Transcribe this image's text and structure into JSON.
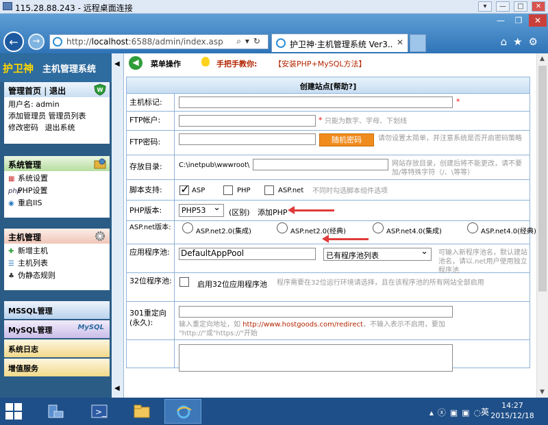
{
  "rdp": {
    "title": "115.28.88.243 - 远程桌面连接",
    "buttons": [
      "▾",
      "—",
      "□",
      "✕"
    ]
  },
  "browser": {
    "url_prefix": "http://",
    "url_host": "localhost",
    "url_rest": ":6588/admin/index.asp",
    "addr_tools": "⌕▾↻",
    "tab_label": "护卫神·主机管理系统 Ver3...",
    "tab_close": "✕",
    "window_buttons": [
      "—",
      "❐",
      "✕"
    ],
    "right_icons": "⌂★⚙",
    "back": "←",
    "forward": "→"
  },
  "sidebar": {
    "brand_name": "护卫神",
    "brand_sub": "主机管理系统",
    "collapse_arrow": "◀",
    "account_panel": {
      "home_label": "管理首页",
      "logout_label": "退出",
      "username_line": "用户名: admin",
      "add_admin": "添加管理员",
      "admin_list": "管理员列表",
      "change_pwd": "修改密码",
      "exit_system": "退出系统"
    },
    "system_panel": {
      "title": "系统管理",
      "items": [
        "系统设置",
        "PHP设置",
        "重启IIS"
      ],
      "prefix_php": "php"
    },
    "host_panel": {
      "title": "主机管理",
      "items": [
        "新增主机",
        "主机列表",
        "伪静态规则"
      ]
    },
    "bars": [
      "MSSQL管理",
      "MySQL管理",
      "系统日志",
      "增值服务"
    ],
    "mysql_logo": "MySQL"
  },
  "toolbar": {
    "menu_label": "菜单操作",
    "teach_label": "手把手教你:",
    "install_link": "【安装PHP+MySQL方法】"
  },
  "form": {
    "title": "创建站点[帮助?]",
    "rows": {
      "host_label": "主机标记:",
      "host_value": "",
      "ftp_user_label": "FTP帐户:",
      "ftp_user_hint": "只能为数字、字母、下划线",
      "ftp_pwd_label": "FTP密码:",
      "random_pwd_button": "随机密码",
      "ftp_pwd_hint": "请勿设置太简单，并注意系统是否开启密码策略",
      "dir_label": "存放目录:",
      "dir_prefix": "C:\\inetpub\\wwwroot\\",
      "dir_hint": "网站存放目录，创建后将不能更改，请不要加/等特殊字符（/、\\等等）",
      "script_label": "脚本支持:",
      "asp_label": "ASP",
      "php_label": "PHP",
      "aspnet_label": "ASP.net",
      "script_hint": "不同时勾选脚本组件选项",
      "php_version_label": "PHP版本:",
      "php_version_value": "PHP53",
      "php_diff": "(区别)",
      "php_add": "添加PHP",
      "aspnet_version_label": "ASP.net版本:",
      "aspnet_options": [
        "ASP.net2.0(集成)",
        "ASP.net2.0(经典)",
        "ASP.net4.0(集成)",
        "ASP.net4.0(经典)"
      ],
      "pool_label": "应用程序池:",
      "pool_value": "DefaultAppPool",
      "pool_select": "已有程序池列表",
      "pool_hint": "可输入新程序池名，默认建站池名，请以.net用户使用独立程序池",
      "bit32_label": "32位程序池:",
      "bit32_option": "启用32位应用程序池",
      "bit32_hint": "程序需要在32位运行环境请选择，且在该程序池的所有网站全部启用",
      "redirect_label": "301重定向(永久):",
      "redirect_hint_a": "输入重定向地址，如",
      "redirect_hint_url": "http://www.hostgoods.com/redirect",
      "redirect_hint_b": "，不输入表示不启用，要加",
      "redirect_hint_c": "\"http://\"或\"https://\"开始",
      "required_mark": "*"
    }
  },
  "taskbar": {
    "time": "14:27",
    "date": "2015/12/18",
    "ime": "英",
    "tray_icons": "▴ⓧ▣▣◌"
  },
  "colors": {
    "accent_blue": "#2f74b7",
    "sidebar_bg": "#2a5c86",
    "brand_yellow": "#ffd800",
    "orange_button": "#f08c1e",
    "annotation_red": "#e03a3a"
  }
}
